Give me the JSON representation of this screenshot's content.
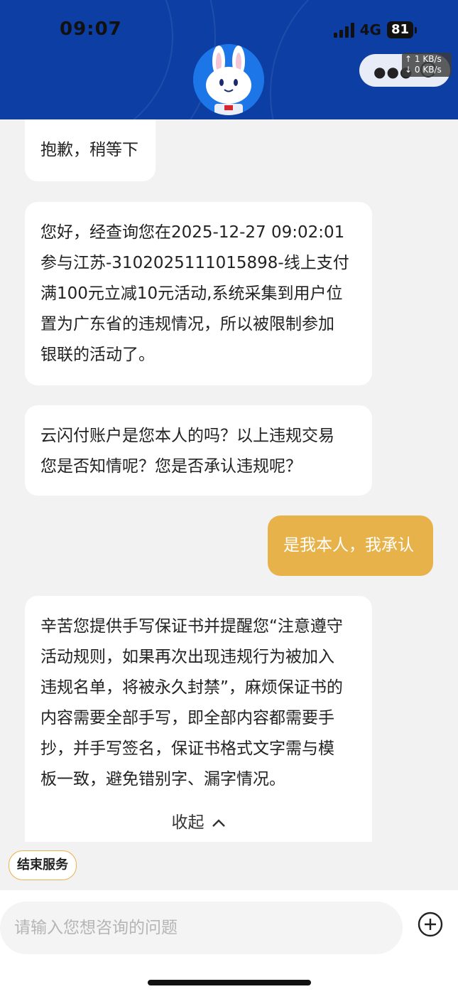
{
  "status_bar": {
    "time": "09:07",
    "network": "4G",
    "battery": "81"
  },
  "header": {
    "menu_icon": "ellipsis-icon",
    "close_icon": "close-circle-icon",
    "speed_up": "↑ 1 KB/s",
    "speed_down": "↓ 0 KB/s",
    "brand_color": "#0d3ea3"
  },
  "messages": [
    {
      "from": "agent",
      "text": "抱歉，稍等下"
    },
    {
      "from": "agent",
      "lines": [
        "您好，经查询您在2025-12-27 09:02:01",
        "参与江苏-3102025111015898-线上支付",
        "满100元立减10元活动,系统采集到用户位",
        "置为广东省的违规情况，所以被限制参加",
        "银联的活动了。"
      ]
    },
    {
      "from": "agent",
      "lines": [
        "云闪付账户是您本人的吗？以上违规交易",
        "您是否知情呢？您是否承认违规呢？"
      ]
    },
    {
      "from": "user",
      "text": "是我本人，我承认"
    },
    {
      "from": "agent",
      "lines": [
        "辛苦您提供手写保证书并提醒您“注意遵守",
        "活动规则，如果再次出现违规行为被加入",
        "违规名单，将被永久封禁”，麻烦保证书的",
        "内容需要全部手写，即全部内容都需要手",
        "抄，并手写签名，保证书格式文字需与模",
        "板一致，避免错别字、漏字情况。"
      ],
      "collapse_label": "收起"
    }
  ],
  "actions": {
    "end_service": "结束服务"
  },
  "input": {
    "placeholder": "请输入您想咨询的问题"
  },
  "colors": {
    "user_bubble": "#e8b24a",
    "agent_bubble": "#ffffff",
    "background": "#f2f2f2"
  }
}
